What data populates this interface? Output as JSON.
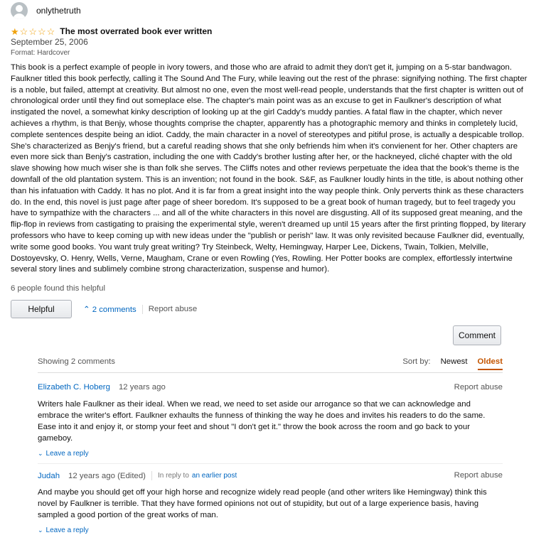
{
  "review": {
    "author": "onlythetruth",
    "stars_filled": 1,
    "stars_total": 5,
    "title": "The most overrated book ever written",
    "date": "September 25, 2006",
    "format": "Format: Hardcover",
    "body": "This book is a perfect example of people in ivory towers, and those who are afraid to admit they don't get it, jumping on a 5-star bandwagon. Faulkner titled this book perfectly, calling it The Sound And The Fury, while leaving out the rest of the phrase: signifying nothing. The first chapter is a noble, but failed, attempt at creativity. But almost no one, even the most well-read people, understands that the first chapter is written out of chronological order until they find out someplace else. The chapter's main point was as an excuse to get in Faulkner's description of what instigated the novel, a somewhat kinky description of looking up at the girl Caddy's muddy panties. A fatal flaw in the chapter, which never achieves a rhythm, is that Benjy, whose thoughts comprise the chapter, apparently has a photographic memory and thinks in completely lucid, complete sentences despite being an idiot. Caddy, the main character in a novel of stereotypes and pitiful prose, is actually a despicable trollop. She's characterized as Benjy's friend, but a careful reading shows that she only befriends him when it's convienent for her. Other chapters are even more sick than Benjy's castration, including the one with Caddy's brother lusting after her, or the hackneyed, cliché chapter with the old slave showing how much wiser she is than folk she serves. The Cliffs notes and other reviews perpetuate the idea that the book's theme is the downfall of the old plantation system. This is an invention; not found in the book. S&F, as Faulkner loudly hints in the title, is about nothing other than his infatuation with Caddy. It has no plot. And it is far from a great insight into the way people think. Only perverts think as these characters do. In the end, this novel is just page after page of sheer boredom. It's supposed to be a great book of human tragedy, but to feel tragedy you have to sympathize with the characters ... and all of the white characters in this novel are disgusting. All of its supposed great meaning, and the flip-flop in reviews from castigating to praising the experimental style, weren't dreamed up until 15 years after the first printing flopped, by literary professors who have to keep coming up with new ideas under the \"publish or perish\" law. It was only revisited because Faulkner did, eventually, write some good books. You want truly great writing? Try Steinbeck, Welty, Hemingway, Harper Lee, Dickens, Twain, Tolkien, Melville, Dostoyevsky, O. Henry, Wells, Verne, Maugham, Crane or even Rowling (Yes, Rowling. Her Potter books are complex, effortlessly intertwine several story lines and sublimely combine strong characterization, suspense and humor).",
    "helpful_count": "6 people found this helpful",
    "helpful_button": "Helpful",
    "comments_link": "2 comments",
    "report_abuse": "Report abuse"
  },
  "comments_section": {
    "comment_button": "Comment",
    "showing": "Showing 2 comments",
    "sort_label": "Sort by:",
    "sort_options": [
      "Newest",
      "Oldest"
    ],
    "active_sort": "Oldest",
    "comments": [
      {
        "author": "Elizabeth C. Hoberg",
        "time": "12 years ago",
        "report": "Report abuse",
        "text": "Writers hale Faulkner as their ideal. When we read, we need to set aside our arrogance so that we can acknowledge and embrace the writer's effort. Faulkner exhaults the funness of thinking the way he does and invites his readers to do the same. Ease into it and enjoy it, or stomp your feet and shout \"I don't get it.\" throw the book across the room and go back to your gameboy.",
        "reply": "Leave a reply"
      },
      {
        "author": "Judah",
        "time": "12 years ago (Edited)",
        "in_reply_label": "In reply to",
        "in_reply_link": "an earlier post",
        "report": "Report abuse",
        "text": "And maybe you should get off your high horse and recognize widely read people (and other writers like Hemingway) think this novel by Faulkner is terrible. That they have formed opinions not out of stupidity, but out of a large experience basis, having sampled a good portion of the great works of man.",
        "reply": "Leave a reply"
      }
    ]
  }
}
